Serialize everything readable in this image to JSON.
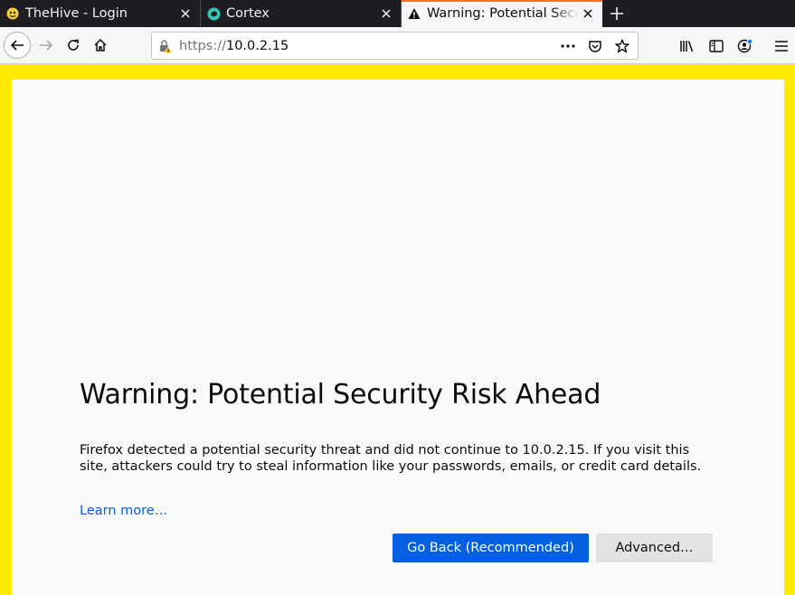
{
  "tabs": [
    {
      "title": "TheHive - Login",
      "icon": "thehive-icon"
    },
    {
      "title": "Cortex",
      "icon": "cortex-icon"
    },
    {
      "title": "Warning: Potential Security Risk Ahead",
      "icon": "warning-icon",
      "active": true
    }
  ],
  "urlbar": {
    "scheme": "https://",
    "host": "10.0.2.15"
  },
  "page": {
    "title": "Warning: Potential Security Risk Ahead",
    "description": "Firefox detected a potential security threat and did not continue to 10.0.2.15. If you visit this site, attackers could try to steal information like your passwords, emails, or credit card details.",
    "learn_more": "Learn more…",
    "go_back": "Go Back (Recommended)",
    "advanced": "Advanced…"
  },
  "colors": {
    "border_warning": "#ffe900",
    "primary_button": "#0060df",
    "link": "#0060df"
  }
}
